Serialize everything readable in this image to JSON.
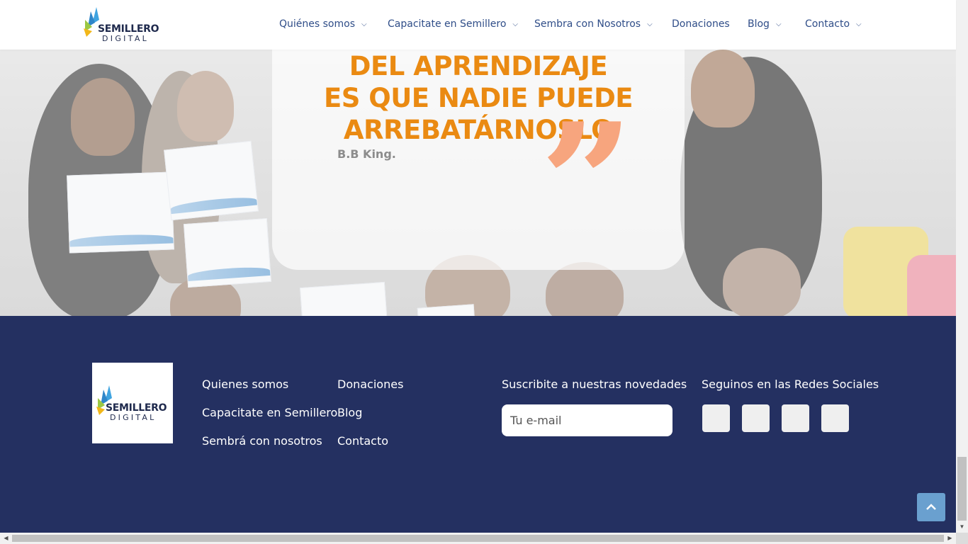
{
  "header": {
    "logo": {
      "line1": "SEMILLERO",
      "line2": "DIGITAL"
    },
    "nav": [
      {
        "label": "Quiénes somos",
        "has_dropdown": true
      },
      {
        "label": "Capacitate en Semillero",
        "has_dropdown": true
      },
      {
        "label": "Sembra con Nosotros",
        "has_dropdown": true
      },
      {
        "label": "Donaciones",
        "has_dropdown": false
      },
      {
        "label": "Blog",
        "has_dropdown": true
      },
      {
        "label": "Contacto",
        "has_dropdown": true
      }
    ]
  },
  "quote": {
    "lines": [
      "DEL APRENDIZAJE",
      "ES QUE NADIE PUEDE",
      "ARREBATÁRNOSLO"
    ],
    "author": "B.B King.",
    "mark": "”"
  },
  "footer": {
    "logo": {
      "line1": "SEMILLERO",
      "line2": "DIGITAL"
    },
    "links_col1": [
      "Quienes somos",
      "Capacitate en Semillero",
      "Sembrá con nosotros"
    ],
    "links_col2": [
      "Donaciones",
      "Blog",
      "Contacto"
    ],
    "subscribe_heading": "Suscribite a nuestras novedades",
    "email_placeholder": "Tu e-mail",
    "social_heading": "Seguinos en las Redes Sociales",
    "social_icons": [
      "social-icon-1",
      "social-icon-2",
      "social-icon-3",
      "social-icon-4"
    ]
  },
  "colors": {
    "accent_orange": "#ea8a12",
    "footer_bg": "#243061",
    "nav_text": "#2f4d88",
    "scroll_top_button": "#6aa0cf"
  }
}
